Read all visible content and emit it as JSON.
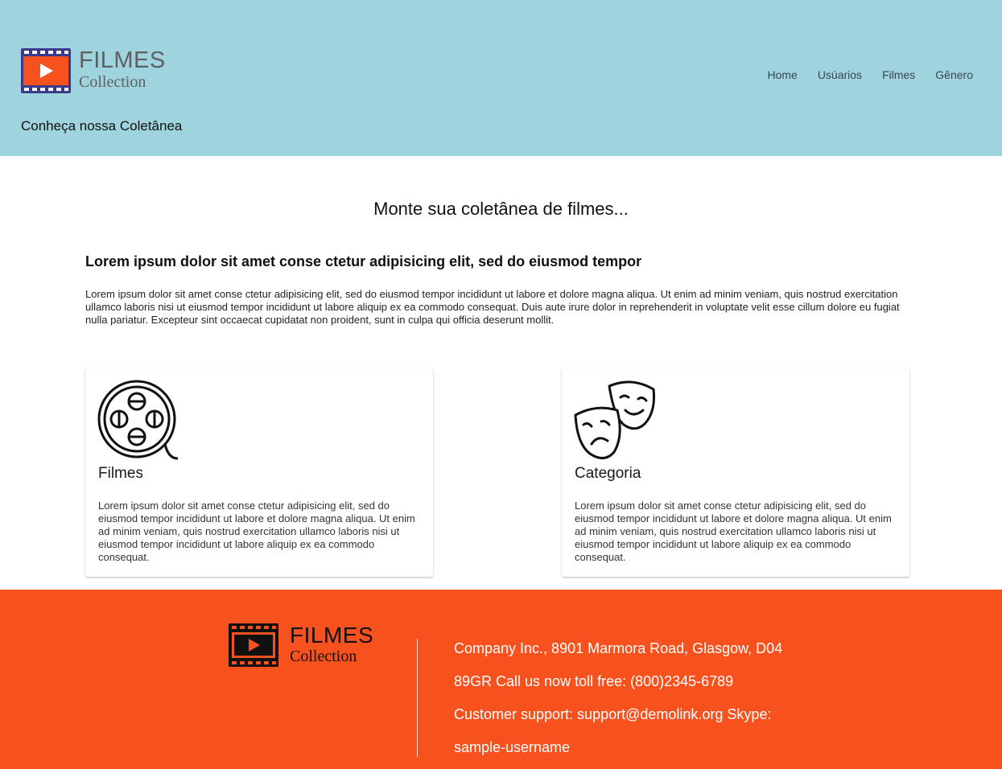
{
  "header": {
    "logo_title": "FILMES",
    "logo_subtitle": "Collection",
    "tagline": "Conheça nossa Coletânea",
    "nav": [
      "Home",
      "Usúarios",
      "Filmes",
      "Gênero"
    ]
  },
  "main": {
    "title": "Monte sua coletânea de filmes...",
    "subheading": "Lorem ipsum dolor sit amet conse ctetur adipisicing elit, sed do eiusmod tempor",
    "intro": "Lorem ipsum dolor sit amet conse ctetur adipisicing elit, sed do eiusmod tempor incididunt ut labore et dolore magna aliqua. Ut enim ad minim veniam, quis nostrud exercitation ullamco laboris nisi ut eiusmod tempor incididunt ut labore aliquip ex ea commodo consequat. Duis aute irure dolor in reprehenderit in voluptate velit esse cillum dolore eu fugiat nulla pariatur. Excepteur sint occaecat cupidatat non proident, sunt in culpa qui officia deserunt mollit.",
    "cards": [
      {
        "icon": "film-reel-icon",
        "title": "Filmes",
        "text": "Lorem ipsum dolor sit amet conse ctetur adipisicing elit, sed do eiusmod tempor incididunt ut labore et dolore magna aliqua. Ut enim ad minim veniam, quis nostrud exercitation ullamco laboris nisi ut eiusmod tempor incididunt ut labore aliquip ex ea commodo consequat."
      },
      {
        "icon": "theater-masks-icon",
        "title": "Categoria",
        "text": "Lorem ipsum dolor sit amet conse ctetur adipisicing elit, sed do eiusmod tempor incididunt ut labore et dolore magna aliqua. Ut enim ad minim veniam, quis nostrud exercitation ullamco laboris nisi ut eiusmod tempor incididunt ut labore aliquip ex ea commodo consequat."
      }
    ]
  },
  "footer": {
    "logo_title": "FILMES",
    "logo_subtitle": "Collection",
    "lines": [
      "Company Inc., 8901 Marmora Road, Glasgow, D04",
      "89GR Call us now toll free: (800)2345-6789",
      "Customer support: support@demolink.org Skype:",
      "sample-username"
    ]
  },
  "colors": {
    "header_bg": "#9fd3de",
    "footer_bg": "#f7511e",
    "logo_film": "#3a3a8c",
    "logo_screen": "#f7511e"
  }
}
